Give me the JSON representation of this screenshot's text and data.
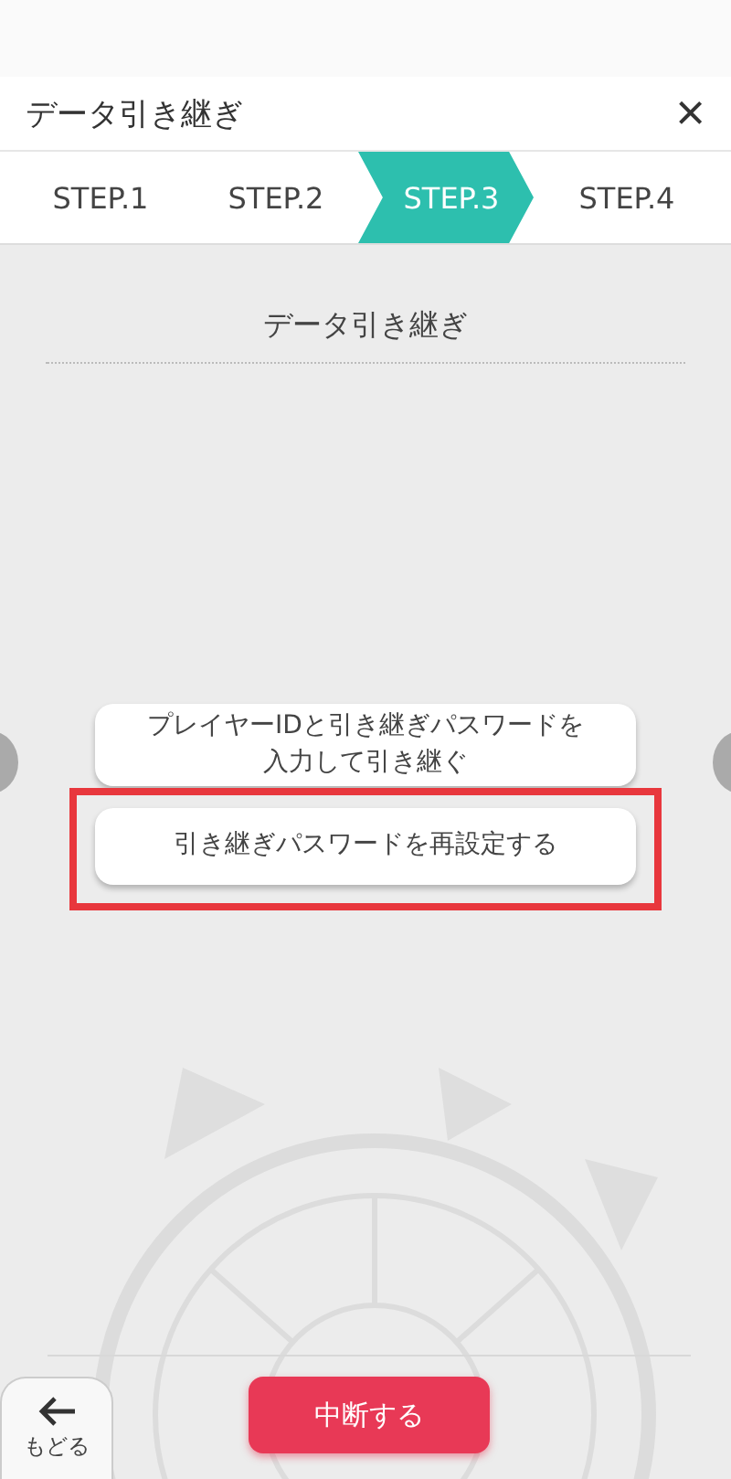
{
  "header": {
    "title": "データ引き継ぎ",
    "close": "×"
  },
  "steps": [
    {
      "label": "STEP.1",
      "selected": false
    },
    {
      "label": "STEP.2",
      "selected": false
    },
    {
      "label": "STEP.3",
      "selected": true
    },
    {
      "label": "STEP.4",
      "selected": false
    }
  ],
  "section_title": "データ引き継ぎ",
  "options": [
    {
      "label": "プレイヤーIDと引き継ぎパスワードを入力して引き継ぐ",
      "highlighted": false
    },
    {
      "label": "引き継ぎパスワードを再設定する",
      "highlighted": true
    }
  ],
  "footer": {
    "back_label": "もどる",
    "cancel_label": "中断する"
  }
}
